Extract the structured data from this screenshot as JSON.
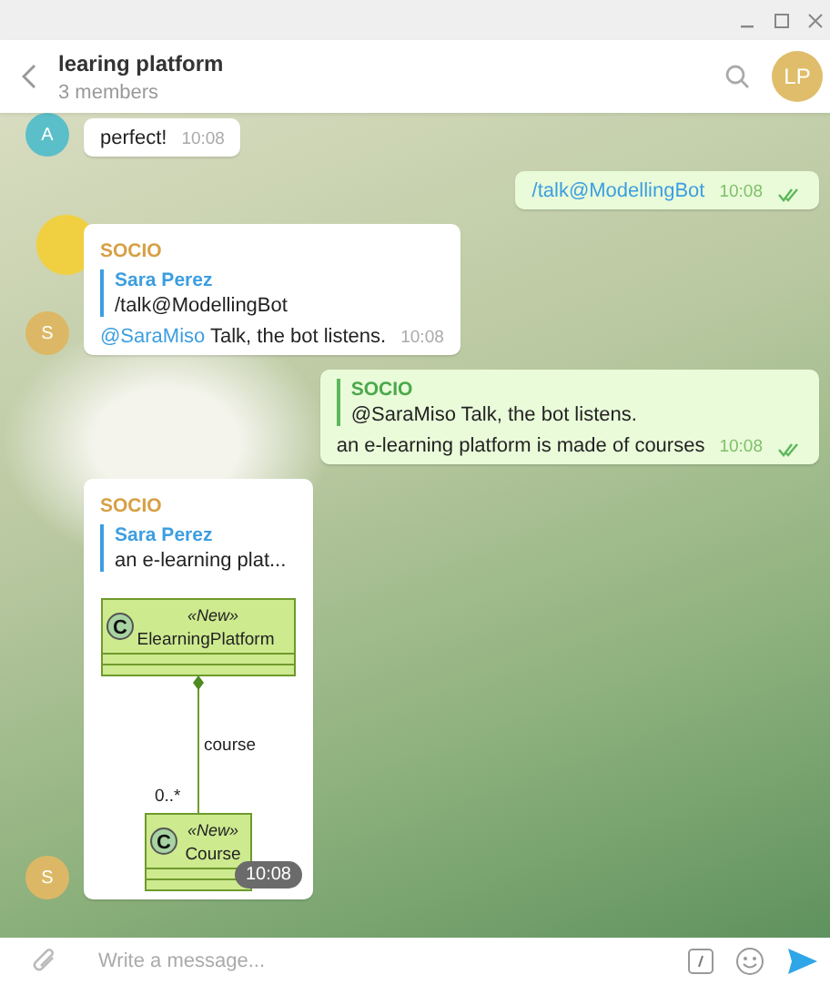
{
  "header": {
    "title": "learing platform",
    "subtitle": "3 members",
    "avatar": "LP"
  },
  "messages": [
    {
      "kind": "incoming",
      "avatar": "A",
      "color": "#5bbfc9",
      "text": "perfect!",
      "time": "10:08"
    },
    {
      "kind": "outgoing",
      "text": "/talk@ModellingBot",
      "link": true,
      "time": "10:08",
      "read": true
    },
    {
      "kind": "incoming",
      "avatar": "S",
      "color": "#dcb866",
      "author": "SOCIO",
      "reply": {
        "author": "Sara Perez",
        "text": "/talk@ModellingBot"
      },
      "mention": "@SaraMiso",
      "text": "Talk, the bot listens.",
      "time": "10:08"
    },
    {
      "kind": "outgoing",
      "reply": {
        "author": "SOCIO",
        "text": "@SaraMiso Talk, the bot listens."
      },
      "text": "an e-learning platform is made of courses",
      "time": "10:08",
      "read": true
    },
    {
      "kind": "incoming",
      "avatar": "S",
      "color": "#dcb866",
      "author": "SOCIO",
      "reply": {
        "author": "Sara Perez",
        "text": "an e-learning plat..."
      },
      "diagram": {
        "classes": [
          {
            "badge": "C",
            "stereotype": "«New»",
            "name": "ElearningPlatform"
          },
          {
            "badge": "C",
            "stereotype": "«New»",
            "name": "Course"
          }
        ],
        "association": "course",
        "multiplicity": "0..*"
      },
      "time": "10:08"
    }
  ],
  "composer": {
    "placeholder": "Write a message..."
  }
}
